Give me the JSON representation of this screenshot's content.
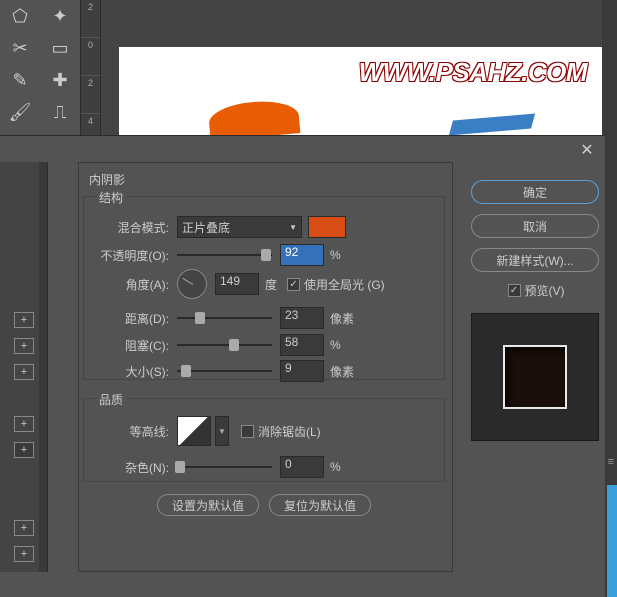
{
  "ruler": {
    "t1": "2",
    "t2": "0",
    "t3": "2",
    "t4": "4"
  },
  "logo": "WWW.PSAHZ.COM",
  "dialog": {
    "section_inner_shadow": "内阴影",
    "section_structure": "结构",
    "blend_mode_label": "混合模式:",
    "blend_mode_value": "正片叠底",
    "opacity_label": "不透明度(O):",
    "opacity_value": "92",
    "pct": "%",
    "angle_label": "角度(A):",
    "angle_value": "149",
    "degree": "度",
    "use_global_light": "使用全局光 (G)",
    "distance_label": "距离(D):",
    "distance_value": "23",
    "px": "像素",
    "choke_label": "阻塞(C):",
    "choke_value": "58",
    "size_label": "大小(S):",
    "size_value": "9",
    "section_quality": "品质",
    "contour_label": "等高线:",
    "antialias": "消除锯齿(L)",
    "noise_label": "杂色(N):",
    "noise_value": "0",
    "set_default": "设置为默认值",
    "reset_default": "复位为默认值",
    "color_swatch": "#d84e15"
  },
  "actions": {
    "ok": "确定",
    "cancel": "取消",
    "new_style": "新建样式(W)...",
    "preview": "预览(V)"
  }
}
